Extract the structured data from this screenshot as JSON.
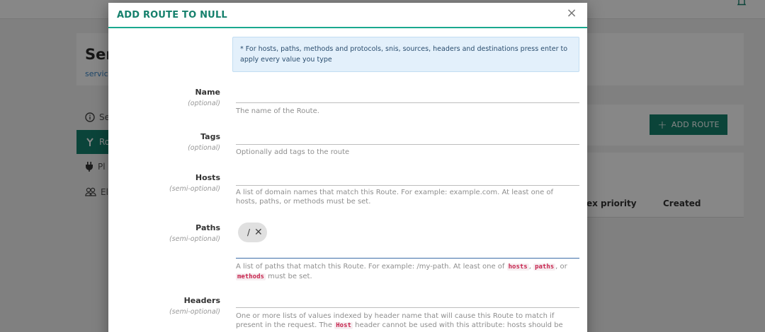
{
  "background": {
    "header": {
      "title": "Ser",
      "subtitle": "service"
    },
    "nav": [
      {
        "label": "Se",
        "icon": "info-icon"
      },
      {
        "label": "Ro",
        "icon": "route-icon"
      },
      {
        "label": "Pl",
        "icon": "plug-icon"
      },
      {
        "label": "El",
        "icon": "users-icon"
      }
    ],
    "add_route_label": "ADD ROUTE",
    "table": {
      "col_priority": "ex priority",
      "col_created": "Created"
    }
  },
  "modal": {
    "title": "ADD ROUTE TO NULL",
    "close_symbol": "×",
    "info": "* For hosts, paths, methods and protocols, snis, sources, headers and destinations press enter to apply every value you type",
    "fields": {
      "name": {
        "label": "Name",
        "sub": "(optional)",
        "help": "The name of the Route."
      },
      "tags": {
        "label": "Tags",
        "sub": "(optional)",
        "help": "Optionally add tags to the route"
      },
      "hosts": {
        "label": "Hosts",
        "sub": "(semi-optional)",
        "help": "A list of domain names that match this Route. For example: example.com. At least one of hosts, paths, or methods must be set."
      },
      "paths": {
        "label": "Paths",
        "sub": "(semi-optional)",
        "chip": "/",
        "chip_remove": "✕",
        "help_before": "A list of paths that match this Route. For example: /my-path. At least one of ",
        "code1": "hosts",
        "sep1": ", ",
        "code2": "paths",
        "sep2": ", or ",
        "code3": "methods",
        "help_after": " must be set."
      },
      "headers": {
        "label": "Headers",
        "sub": "(semi-optional)",
        "help_before": "One or more lists of values indexed by header name that will cause this Route to match if present in the request. The ",
        "code1": "Host",
        "help_after": " header cannot be used with this attribute: hosts should be"
      }
    }
  },
  "colors": {
    "accent": "#15806c",
    "title_accent": "#1aa98f",
    "info_bg": "#e3f0fb",
    "code_fg": "#c7254e"
  }
}
